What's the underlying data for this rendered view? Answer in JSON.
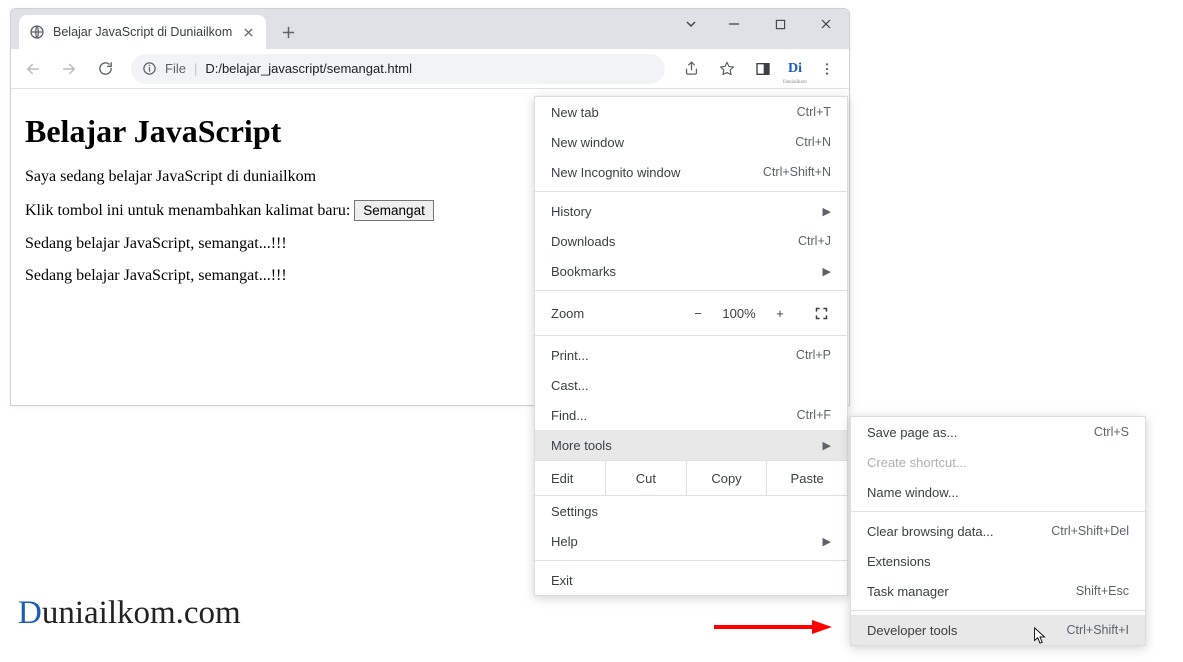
{
  "window": {
    "tab_title": "Belajar JavaScript di Duniailkom",
    "file_label": "File",
    "url_path": "D:/belajar_javascript/semangat.html"
  },
  "page": {
    "heading": "Belajar JavaScript",
    "line1": "Saya sedang belajar JavaScript di duniailkom",
    "line2_prefix": "Klik tombol ini untuk menambahkan kalimat baru: ",
    "button_label": "Semangat",
    "repeat_line": "Sedang belajar JavaScript, semangat...!!!"
  },
  "menu": {
    "new_tab": {
      "label": "New tab",
      "shortcut": "Ctrl+T"
    },
    "new_window": {
      "label": "New window",
      "shortcut": "Ctrl+N"
    },
    "new_incognito": {
      "label": "New Incognito window",
      "shortcut": "Ctrl+Shift+N"
    },
    "history": {
      "label": "History"
    },
    "downloads": {
      "label": "Downloads",
      "shortcut": "Ctrl+J"
    },
    "bookmarks": {
      "label": "Bookmarks"
    },
    "zoom": {
      "label": "Zoom",
      "value": "100%"
    },
    "print": {
      "label": "Print...",
      "shortcut": "Ctrl+P"
    },
    "cast": {
      "label": "Cast..."
    },
    "find": {
      "label": "Find...",
      "shortcut": "Ctrl+F"
    },
    "more_tools": {
      "label": "More tools"
    },
    "edit": {
      "label": "Edit",
      "cut": "Cut",
      "copy": "Copy",
      "paste": "Paste"
    },
    "settings": {
      "label": "Settings"
    },
    "help": {
      "label": "Help"
    },
    "exit": {
      "label": "Exit"
    }
  },
  "submenu": {
    "save_page": {
      "label": "Save page as...",
      "shortcut": "Ctrl+S"
    },
    "create_shortcut": {
      "label": "Create shortcut..."
    },
    "name_window": {
      "label": "Name window..."
    },
    "clear_browsing": {
      "label": "Clear browsing data...",
      "shortcut": "Ctrl+Shift+Del"
    },
    "extensions": {
      "label": "Extensions"
    },
    "task_manager": {
      "label": "Task manager",
      "shortcut": "Shift+Esc"
    },
    "developer_tools": {
      "label": "Developer tools",
      "shortcut": "Ctrl+Shift+I"
    }
  },
  "watermark": {
    "d": "D",
    "rest": "uniailkom.com"
  },
  "ext": {
    "label": "Di",
    "sub": "Duniailkom"
  }
}
